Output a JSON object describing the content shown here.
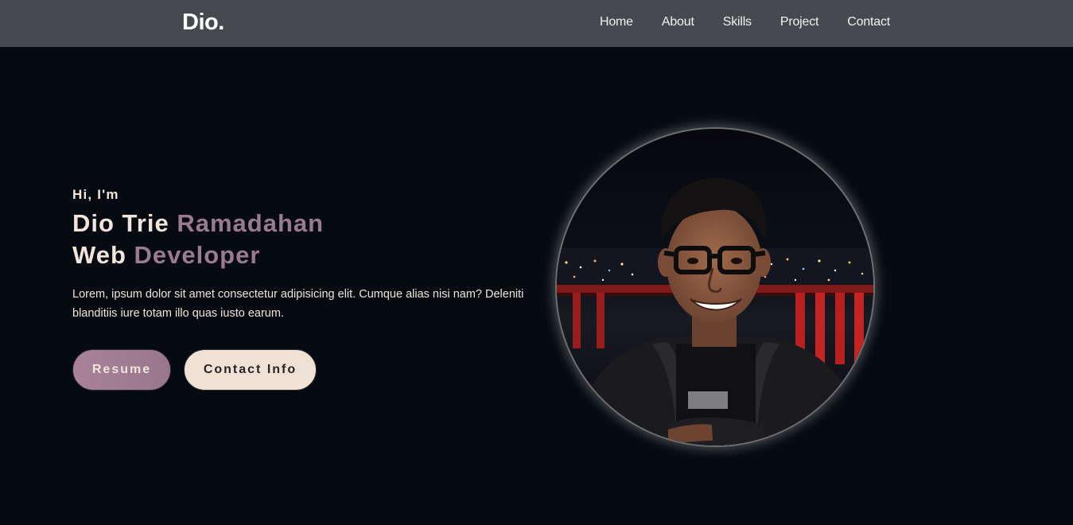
{
  "navbar": {
    "brand": "Dio.",
    "links": [
      {
        "label": "Home"
      },
      {
        "label": "About"
      },
      {
        "label": "Skills"
      },
      {
        "label": "Project"
      },
      {
        "label": "Contact"
      }
    ]
  },
  "hero": {
    "greeting": "Hi, I'm",
    "name_first": "Dio Trie",
    "name_last": "Ramadahan",
    "role_first": "Web",
    "role_last": "Developer",
    "description": "Lorem, ipsum dolor sit amet consectetur adipisicing elit. Cumque alias nisi nam? Deleniti blanditiis iure totam illo quas iusto earum.",
    "buttons": {
      "resume": "Resume",
      "contact": "Contact Info"
    },
    "photo_icon": "profile-photo"
  },
  "colors": {
    "navbar_bg": "#46494d",
    "page_bg": "#050b11",
    "text_light": "#f1e4da",
    "accent": "#9a7a8f",
    "resume_button": "#a88298",
    "contact_button": "#efe1d5"
  }
}
